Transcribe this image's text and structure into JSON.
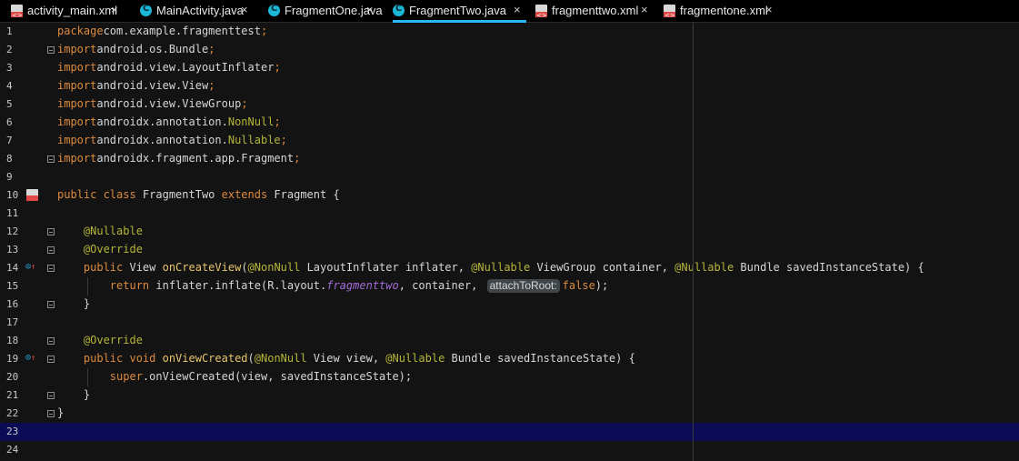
{
  "tabs": [
    {
      "label": "activity_main.xml",
      "icon": "xml-file-icon",
      "active": false
    },
    {
      "label": "MainActivity.java",
      "icon": "java-class-icon",
      "active": false
    },
    {
      "label": "FragmentOne.java",
      "icon": "java-class-icon",
      "active": false
    },
    {
      "label": "FragmentTwo.java",
      "icon": "java-class-icon",
      "active": true
    },
    {
      "label": "fragmenttwo.xml",
      "icon": "xml-file-icon",
      "active": false
    },
    {
      "label": "fragmentone.xml",
      "icon": "xml-file-icon",
      "active": false
    }
  ],
  "tab_close_glyph": "×",
  "java_icon_letter": "C",
  "xml_icon_glyph": "<>",
  "colors": {
    "background": "#131313",
    "keyword": "#dc8a3f",
    "annotation": "#b5b53a",
    "field": "#a36bd6",
    "current_line": "#0a0a55",
    "active_tab_underline": "#29b6f6"
  },
  "current_line": 23,
  "lines": [
    {
      "n": "1",
      "segs": [
        [
          "kw",
          "package"
        ],
        [
          "",
          "com.example.fragmenttest"
        ],
        [
          "kw",
          ";"
        ]
      ]
    },
    {
      "n": "2",
      "segs": [
        [
          "kw",
          "import"
        ],
        [
          "",
          "android.os.Bundle"
        ],
        [
          "kw",
          ";"
        ]
      ]
    },
    {
      "n": "3",
      "segs": [
        [
          "kw",
          "import"
        ],
        [
          "",
          "android.view.LayoutInflater"
        ],
        [
          "kw",
          ";"
        ]
      ]
    },
    {
      "n": "4",
      "segs": [
        [
          "kw",
          "import"
        ],
        [
          "",
          "android.view.View"
        ],
        [
          "kw",
          ";"
        ]
      ]
    },
    {
      "n": "5",
      "segs": [
        [
          "kw",
          "import"
        ],
        [
          "",
          "android.view.ViewGroup"
        ],
        [
          "kw",
          ";"
        ]
      ]
    },
    {
      "n": "6",
      "segs": [
        [
          "kw",
          "import"
        ],
        [
          "",
          "androidx.annotation."
        ],
        [
          "ann",
          "NonNull"
        ],
        [
          "kw",
          ";"
        ]
      ]
    },
    {
      "n": "7",
      "segs": [
        [
          "kw",
          "import"
        ],
        [
          "",
          "androidx.annotation."
        ],
        [
          "ann",
          "Nullable"
        ],
        [
          "kw",
          ";"
        ]
      ]
    },
    {
      "n": "8",
      "segs": [
        [
          "kw",
          "import"
        ],
        [
          "",
          "androidx.fragment.app.Fragment"
        ],
        [
          "kw",
          ";"
        ]
      ]
    },
    {
      "n": "9",
      "segs": []
    },
    {
      "n": "10",
      "segs": [
        [
          "kw",
          "public class "
        ],
        [
          "",
          "FragmentTwo "
        ],
        [
          "kw",
          "extends "
        ],
        [
          "",
          "Fragment {"
        ]
      ]
    },
    {
      "n": "11",
      "segs": []
    },
    {
      "n": "12",
      "segs": [
        [
          "",
          "    "
        ],
        [
          "ann",
          "@Nullable"
        ]
      ]
    },
    {
      "n": "13",
      "segs": [
        [
          "",
          "    "
        ],
        [
          "ann",
          "@Override"
        ]
      ]
    },
    {
      "n": "14",
      "segs": [
        [
          "",
          "    "
        ],
        [
          "kw",
          "public "
        ],
        [
          "",
          "View "
        ],
        [
          "fn",
          "onCreateView"
        ],
        [
          "",
          "("
        ],
        [
          "ann",
          "@NonNull "
        ],
        [
          "",
          "LayoutInflater inflater, "
        ],
        [
          "ann",
          "@Nullable "
        ],
        [
          "",
          "ViewGroup container, "
        ],
        [
          "ann",
          "@Nullable "
        ],
        [
          "",
          "Bundle savedInstanceState) {"
        ]
      ]
    },
    {
      "n": "15",
      "segs": [
        [
          "",
          "        "
        ],
        [
          "kw",
          "return "
        ],
        [
          "",
          "inflater.inflate(R.layout."
        ],
        [
          "fld",
          "fragmenttwo"
        ],
        [
          "",
          ", container, "
        ],
        [
          "hint",
          "attachToRoot:"
        ],
        [
          "kw",
          "false"
        ],
        [
          "",
          ");"
        ]
      ]
    },
    {
      "n": "16",
      "segs": [
        [
          "",
          "    }"
        ]
      ]
    },
    {
      "n": "17",
      "segs": []
    },
    {
      "n": "18",
      "segs": [
        [
          "",
          "    "
        ],
        [
          "ann",
          "@Override"
        ]
      ]
    },
    {
      "n": "19",
      "segs": [
        [
          "",
          "    "
        ],
        [
          "kw",
          "public void "
        ],
        [
          "fn",
          "onViewCreated"
        ],
        [
          "",
          "("
        ],
        [
          "ann",
          "@NonNull "
        ],
        [
          "",
          "View view, "
        ],
        [
          "ann",
          "@Nullable "
        ],
        [
          "",
          "Bundle savedInstanceState) {"
        ]
      ]
    },
    {
      "n": "20",
      "segs": [
        [
          "",
          "        "
        ],
        [
          "kw",
          "super"
        ],
        [
          "",
          ".onViewCreated(view, savedInstanceState);"
        ]
      ]
    },
    {
      "n": "21",
      "segs": [
        [
          "",
          "    }"
        ]
      ]
    },
    {
      "n": "22",
      "segs": [
        [
          "",
          "}"
        ]
      ]
    },
    {
      "n": "23",
      "segs": []
    },
    {
      "n": "24",
      "segs": []
    }
  ]
}
